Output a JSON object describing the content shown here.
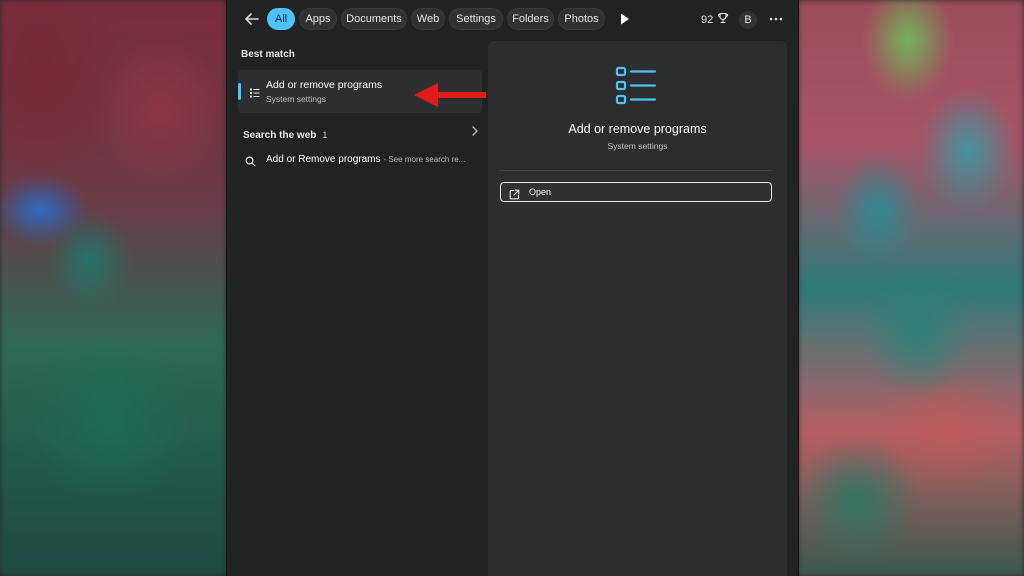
{
  "filters": {
    "items": [
      {
        "label": "All",
        "active": true
      },
      {
        "label": "Apps"
      },
      {
        "label": "Documents"
      },
      {
        "label": "Web"
      },
      {
        "label": "Settings"
      },
      {
        "label": "Folders"
      },
      {
        "label": "Photos"
      }
    ]
  },
  "header": {
    "points": "92",
    "avatar_initial": "B"
  },
  "best_match": {
    "section_title": "Best match",
    "title": "Add or remove programs",
    "subtitle": "System settings"
  },
  "search_web": {
    "section_title": "Search the web",
    "count": "1",
    "result_query": "Add or Remove programs",
    "result_suffix": "- See more search re..."
  },
  "detail": {
    "title": "Add or remove programs",
    "subtitle": "System settings",
    "open_label": "Open"
  },
  "colors": {
    "accent": "#4cc2ff",
    "annotation_arrow": "#e21b1b",
    "panel": "#202223",
    "detail_panel": "#2b2d2f"
  },
  "icons": {
    "back": "back-arrow-icon",
    "play": "play-icon",
    "rewards": "trophy-icon",
    "more": "more-icon",
    "app_list": "list-icon",
    "search": "search-icon",
    "chevron": "chevron-right-icon",
    "open": "open-external-icon"
  }
}
